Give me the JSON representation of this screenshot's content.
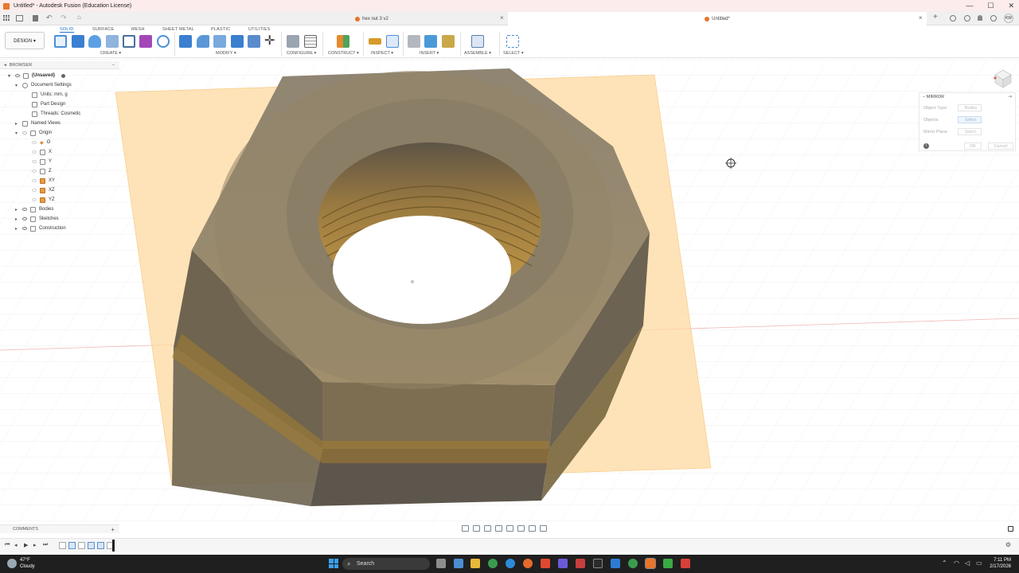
{
  "window": {
    "title": "Untitled* - Autodesk Fusion (Education License)",
    "controls": [
      "—",
      "☐",
      "✕"
    ]
  },
  "doc_tabs": [
    {
      "label": "hex nut 3 v2",
      "active": false
    },
    {
      "label": "Untitled*",
      "active": true
    }
  ],
  "toolbar": {
    "design_label": "DESIGN ▾",
    "workspace_tabs": [
      "SOLID",
      "SURFACE",
      "MESH",
      "SHEET METAL",
      "PLASTIC",
      "UTILITIES"
    ],
    "active_tab": "SOLID",
    "groups": [
      "CREATE ▾",
      "MODIFY ▾",
      "CONFIGURE ▾",
      "CONSTRUCT ▾",
      "INSPECT ▾",
      "INSERT ▾",
      "ASSEMBLE ▾",
      "SELECT ▾"
    ]
  },
  "browser": {
    "header": "BROWSER",
    "items": [
      {
        "label": "(Unsaved)",
        "icon": "document-icon"
      },
      {
        "label": "Document Settings",
        "icon": "gear-icon"
      },
      {
        "label": "Units: mm, g",
        "icon": "document-icon"
      },
      {
        "label": "Part Design",
        "icon": "document-icon"
      },
      {
        "label": "Threads: Cosmetic",
        "icon": "document-icon"
      },
      {
        "label": "Named Views",
        "icon": "folder-icon"
      },
      {
        "label": "Origin",
        "icon": "folder-icon"
      },
      {
        "label": "O",
        "icon": "origin-point-icon"
      },
      {
        "label": "X",
        "icon": "axis-icon"
      },
      {
        "label": "Y",
        "icon": "axis-icon"
      },
      {
        "label": "Z",
        "icon": "axis-icon"
      },
      {
        "label": "XY",
        "icon": "plane-icon"
      },
      {
        "label": "XZ",
        "icon": "plane-icon"
      },
      {
        "label": "YZ",
        "icon": "plane-icon"
      },
      {
        "label": "Bodies",
        "icon": "folder-icon"
      },
      {
        "label": "Sketches",
        "icon": "folder-icon"
      },
      {
        "label": "Construction",
        "icon": "folder-icon"
      }
    ]
  },
  "mirror_panel": {
    "title": "MIRROR",
    "object_type_label": "Object Type",
    "object_type_value": "Bodies",
    "objects_label": "Objects",
    "objects_value": "Select",
    "mirror_plane_label": "Mirror Plane",
    "mirror_plane_value": "Select",
    "ok": "OK",
    "cancel": "Cancel"
  },
  "comments_label": "COMMENTS",
  "taskbar": {
    "temperature": "47°F",
    "weather": "Cloudy",
    "search_placeholder": "Search",
    "time": "7:11 PM",
    "date": "2/17/2026"
  },
  "colors": {
    "accent": "#1a6fc9",
    "nut_body": "#8a7a5e",
    "plane": "#ffd9a0",
    "brand": "#e8752a"
  }
}
